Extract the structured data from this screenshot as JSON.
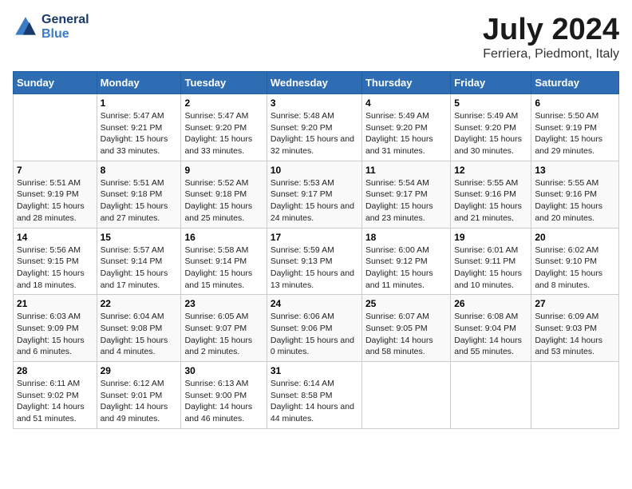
{
  "logo": {
    "line1": "General",
    "line2": "Blue"
  },
  "title": "July 2024",
  "subtitle": "Ferriera, Piedmont, Italy",
  "days_of_week": [
    "Sunday",
    "Monday",
    "Tuesday",
    "Wednesday",
    "Thursday",
    "Friday",
    "Saturday"
  ],
  "weeks": [
    [
      {
        "num": "",
        "sunrise": "",
        "sunset": "",
        "daylight": ""
      },
      {
        "num": "1",
        "sunrise": "Sunrise: 5:47 AM",
        "sunset": "Sunset: 9:21 PM",
        "daylight": "Daylight: 15 hours and 33 minutes."
      },
      {
        "num": "2",
        "sunrise": "Sunrise: 5:47 AM",
        "sunset": "Sunset: 9:20 PM",
        "daylight": "Daylight: 15 hours and 33 minutes."
      },
      {
        "num": "3",
        "sunrise": "Sunrise: 5:48 AM",
        "sunset": "Sunset: 9:20 PM",
        "daylight": "Daylight: 15 hours and 32 minutes."
      },
      {
        "num": "4",
        "sunrise": "Sunrise: 5:49 AM",
        "sunset": "Sunset: 9:20 PM",
        "daylight": "Daylight: 15 hours and 31 minutes."
      },
      {
        "num": "5",
        "sunrise": "Sunrise: 5:49 AM",
        "sunset": "Sunset: 9:20 PM",
        "daylight": "Daylight: 15 hours and 30 minutes."
      },
      {
        "num": "6",
        "sunrise": "Sunrise: 5:50 AM",
        "sunset": "Sunset: 9:19 PM",
        "daylight": "Daylight: 15 hours and 29 minutes."
      }
    ],
    [
      {
        "num": "7",
        "sunrise": "Sunrise: 5:51 AM",
        "sunset": "Sunset: 9:19 PM",
        "daylight": "Daylight: 15 hours and 28 minutes."
      },
      {
        "num": "8",
        "sunrise": "Sunrise: 5:51 AM",
        "sunset": "Sunset: 9:18 PM",
        "daylight": "Daylight: 15 hours and 27 minutes."
      },
      {
        "num": "9",
        "sunrise": "Sunrise: 5:52 AM",
        "sunset": "Sunset: 9:18 PM",
        "daylight": "Daylight: 15 hours and 25 minutes."
      },
      {
        "num": "10",
        "sunrise": "Sunrise: 5:53 AM",
        "sunset": "Sunset: 9:17 PM",
        "daylight": "Daylight: 15 hours and 24 minutes."
      },
      {
        "num": "11",
        "sunrise": "Sunrise: 5:54 AM",
        "sunset": "Sunset: 9:17 PM",
        "daylight": "Daylight: 15 hours and 23 minutes."
      },
      {
        "num": "12",
        "sunrise": "Sunrise: 5:55 AM",
        "sunset": "Sunset: 9:16 PM",
        "daylight": "Daylight: 15 hours and 21 minutes."
      },
      {
        "num": "13",
        "sunrise": "Sunrise: 5:55 AM",
        "sunset": "Sunset: 9:16 PM",
        "daylight": "Daylight: 15 hours and 20 minutes."
      }
    ],
    [
      {
        "num": "14",
        "sunrise": "Sunrise: 5:56 AM",
        "sunset": "Sunset: 9:15 PM",
        "daylight": "Daylight: 15 hours and 18 minutes."
      },
      {
        "num": "15",
        "sunrise": "Sunrise: 5:57 AM",
        "sunset": "Sunset: 9:14 PM",
        "daylight": "Daylight: 15 hours and 17 minutes."
      },
      {
        "num": "16",
        "sunrise": "Sunrise: 5:58 AM",
        "sunset": "Sunset: 9:14 PM",
        "daylight": "Daylight: 15 hours and 15 minutes."
      },
      {
        "num": "17",
        "sunrise": "Sunrise: 5:59 AM",
        "sunset": "Sunset: 9:13 PM",
        "daylight": "Daylight: 15 hours and 13 minutes."
      },
      {
        "num": "18",
        "sunrise": "Sunrise: 6:00 AM",
        "sunset": "Sunset: 9:12 PM",
        "daylight": "Daylight: 15 hours and 11 minutes."
      },
      {
        "num": "19",
        "sunrise": "Sunrise: 6:01 AM",
        "sunset": "Sunset: 9:11 PM",
        "daylight": "Daylight: 15 hours and 10 minutes."
      },
      {
        "num": "20",
        "sunrise": "Sunrise: 6:02 AM",
        "sunset": "Sunset: 9:10 PM",
        "daylight": "Daylight: 15 hours and 8 minutes."
      }
    ],
    [
      {
        "num": "21",
        "sunrise": "Sunrise: 6:03 AM",
        "sunset": "Sunset: 9:09 PM",
        "daylight": "Daylight: 15 hours and 6 minutes."
      },
      {
        "num": "22",
        "sunrise": "Sunrise: 6:04 AM",
        "sunset": "Sunset: 9:08 PM",
        "daylight": "Daylight: 15 hours and 4 minutes."
      },
      {
        "num": "23",
        "sunrise": "Sunrise: 6:05 AM",
        "sunset": "Sunset: 9:07 PM",
        "daylight": "Daylight: 15 hours and 2 minutes."
      },
      {
        "num": "24",
        "sunrise": "Sunrise: 6:06 AM",
        "sunset": "Sunset: 9:06 PM",
        "daylight": "Daylight: 15 hours and 0 minutes."
      },
      {
        "num": "25",
        "sunrise": "Sunrise: 6:07 AM",
        "sunset": "Sunset: 9:05 PM",
        "daylight": "Daylight: 14 hours and 58 minutes."
      },
      {
        "num": "26",
        "sunrise": "Sunrise: 6:08 AM",
        "sunset": "Sunset: 9:04 PM",
        "daylight": "Daylight: 14 hours and 55 minutes."
      },
      {
        "num": "27",
        "sunrise": "Sunrise: 6:09 AM",
        "sunset": "Sunset: 9:03 PM",
        "daylight": "Daylight: 14 hours and 53 minutes."
      }
    ],
    [
      {
        "num": "28",
        "sunrise": "Sunrise: 6:11 AM",
        "sunset": "Sunset: 9:02 PM",
        "daylight": "Daylight: 14 hours and 51 minutes."
      },
      {
        "num": "29",
        "sunrise": "Sunrise: 6:12 AM",
        "sunset": "Sunset: 9:01 PM",
        "daylight": "Daylight: 14 hours and 49 minutes."
      },
      {
        "num": "30",
        "sunrise": "Sunrise: 6:13 AM",
        "sunset": "Sunset: 9:00 PM",
        "daylight": "Daylight: 14 hours and 46 minutes."
      },
      {
        "num": "31",
        "sunrise": "Sunrise: 6:14 AM",
        "sunset": "Sunset: 8:58 PM",
        "daylight": "Daylight: 14 hours and 44 minutes."
      },
      {
        "num": "",
        "sunrise": "",
        "sunset": "",
        "daylight": ""
      },
      {
        "num": "",
        "sunrise": "",
        "sunset": "",
        "daylight": ""
      },
      {
        "num": "",
        "sunrise": "",
        "sunset": "",
        "daylight": ""
      }
    ]
  ]
}
